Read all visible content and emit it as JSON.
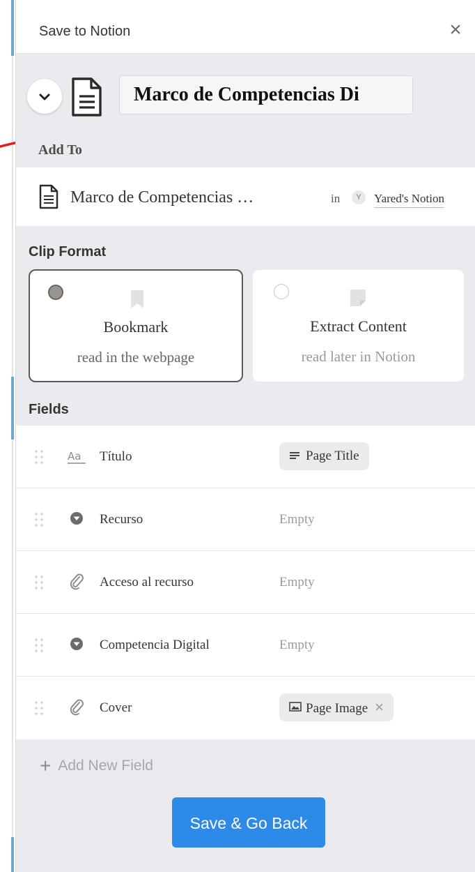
{
  "header": {
    "title": "Save to Notion",
    "close_label": "×"
  },
  "page": {
    "title_value": "Marco de Competencias Di"
  },
  "add_to": {
    "label": "Add To",
    "page_name": "Marco de Competencias …",
    "in_text": "in",
    "workspace_initial": "Y",
    "workspace_name": "Yared's Notion"
  },
  "clip_format": {
    "label": "Clip Format",
    "options": [
      {
        "title": "Bookmark",
        "subtitle": "read in the webpage",
        "selected": true
      },
      {
        "title": "Extract Content",
        "subtitle": "read later in Notion",
        "selected": false
      }
    ]
  },
  "fields": {
    "label": "Fields",
    "rows": [
      {
        "icon": "text-aa-icon",
        "name": "Título",
        "value": "Page Title",
        "value_type": "chip",
        "value_icon": "lines-icon"
      },
      {
        "icon": "select-icon",
        "name": "Recurso",
        "value": "Empty",
        "value_type": "empty"
      },
      {
        "icon": "paperclip-icon",
        "name": "Acceso al recurso",
        "value": "Empty",
        "value_type": "empty"
      },
      {
        "icon": "select-icon",
        "name": "Competencia Digital",
        "value": "Empty",
        "value_type": "empty"
      },
      {
        "icon": "paperclip-icon",
        "name": "Cover",
        "value": "Page Image",
        "value_type": "chip",
        "value_icon": "image-icon",
        "removable": true
      }
    ],
    "add_label": "Add New Field"
  },
  "save_button": "Save & Go Back",
  "colors": {
    "primary": "#2d8ae6",
    "panel_bg": "#ebebef",
    "annotation_arrow": "#e0201b"
  }
}
